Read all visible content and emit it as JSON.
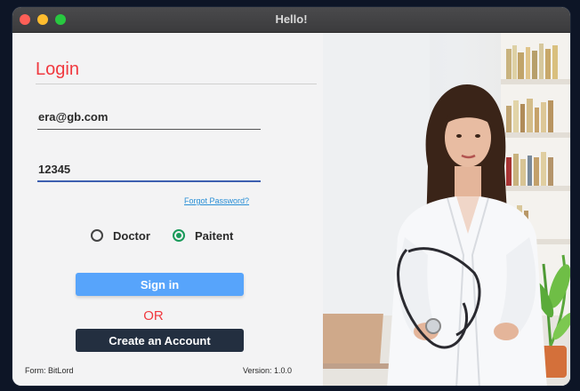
{
  "window": {
    "title": "Hello!"
  },
  "form": {
    "heading": "Login",
    "email_value": "era@gb.com",
    "password_value": "12345",
    "forgot_link": "Forgot Password?",
    "role_options": [
      {
        "label": "Doctor",
        "selected": false
      },
      {
        "label": "Paitent",
        "selected": true
      }
    ],
    "signin_label": "Sign in",
    "or_label": "OR",
    "create_label": "Create an Account",
    "footer_left": "Form: BitLord",
    "footer_right": "Version: 1.0.0"
  },
  "colors": {
    "accent_red": "#f0393f",
    "signin_blue": "#57a4fb",
    "dark_button": "#232f40",
    "radio_green": "#1a9a5a"
  },
  "photo": {
    "subject": "doctor with stethoscope in office"
  }
}
